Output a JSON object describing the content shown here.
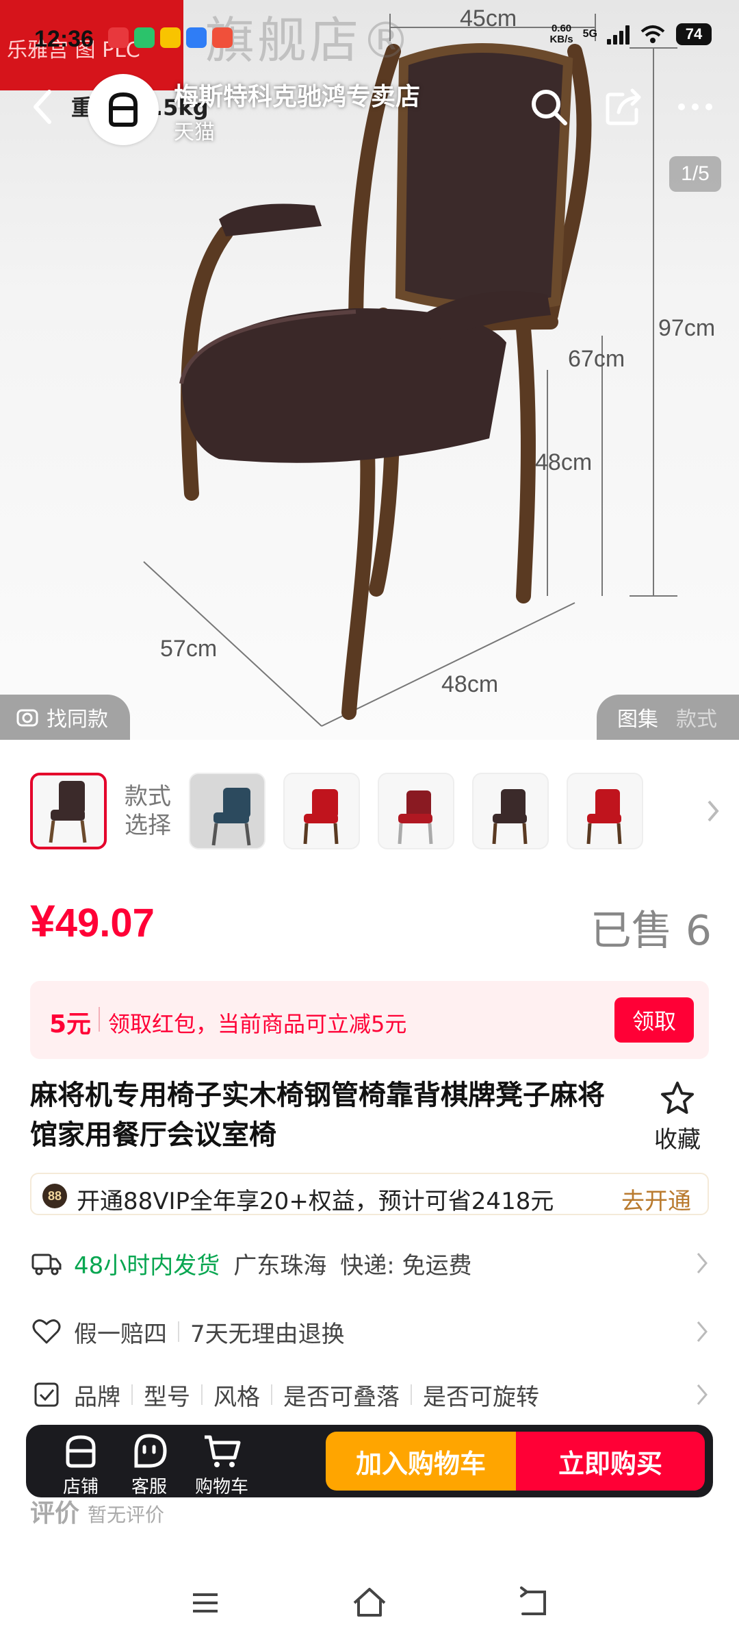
{
  "status_bar": {
    "time": "12:36",
    "net_speed_value": "0.60",
    "net_speed_unit": "KB/s",
    "network": "5G",
    "battery": "74"
  },
  "header": {
    "store_name": "梅斯特科克驰鸿专卖店",
    "store_platform": "天猫"
  },
  "hero": {
    "image_counter": "1/5",
    "find_same_label": "找同款",
    "gallery_tab_1": "图集",
    "gallery_tab_2": "款式",
    "overlay_weight": "重",
    "overlay_weight_value": ".5kg",
    "watermark": "旗舰店®",
    "watermark_left": "乐雅宫 图 PLC",
    "dims": {
      "width_top": "45cm",
      "height_total": "97cm",
      "armrest_height": "67cm",
      "seat_height": "48cm",
      "depth": "57cm",
      "width_bottom": "48cm"
    }
  },
  "variants": {
    "label": "款式选择"
  },
  "price": {
    "symbol": "¥",
    "value": "49.07",
    "sold_label": "已售 6"
  },
  "coupon": {
    "amount": "5元",
    "text": "领取红包，当前商品可立减5元",
    "button": "领取"
  },
  "product": {
    "title": "麻将机专用椅子实木椅钢管椅靠背棋牌凳子麻将馆家用餐厅会议室椅",
    "favorite_label": "收藏"
  },
  "vip": {
    "badge": "88",
    "text": "开通88VIP全年享20+权益，预计可省2418元",
    "cta": "去开通"
  },
  "shipping": {
    "time": "48小时内发货",
    "origin": "广东珠海",
    "express": "快递: 免运费"
  },
  "guarantee": {
    "item1": "假一赔四",
    "item2": "7天无理由退换"
  },
  "params": {
    "item1": "品牌",
    "item2": "型号",
    "item3": "风格",
    "item4": "是否可叠落",
    "item5": "是否可旋转"
  },
  "review": {
    "title": "评价",
    "subtitle": "暂无评价"
  },
  "bottom_bar": {
    "shop": "店铺",
    "service": "客服",
    "cart": "购物车",
    "add_to_cart": "加入购物车",
    "buy_now": "立即购买"
  },
  "colors": {
    "price_red": "#ff0036",
    "cart_orange": "#ffa500",
    "green": "#07a650",
    "vip_gold": "#b97a2e"
  }
}
